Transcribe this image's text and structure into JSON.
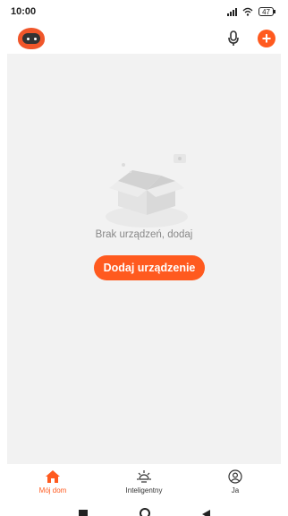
{
  "status_bar": {
    "time": "10:00",
    "battery": "47"
  },
  "header": {
    "mic_icon": "microphone-icon",
    "add_icon": "plus-circle-icon"
  },
  "empty_state": {
    "message": "Brak urządzeń, dodaj",
    "button_label": "Dodaj urządzenie"
  },
  "tabs": [
    {
      "label": "Mój dom",
      "icon": "home-icon",
      "active": true
    },
    {
      "label": "Inteligentny",
      "icon": "sun-icon",
      "active": false
    },
    {
      "label": "Ja",
      "icon": "user-icon",
      "active": false
    }
  ],
  "colors": {
    "accent": "#ff5a1f",
    "background": "#f2f2f2"
  }
}
